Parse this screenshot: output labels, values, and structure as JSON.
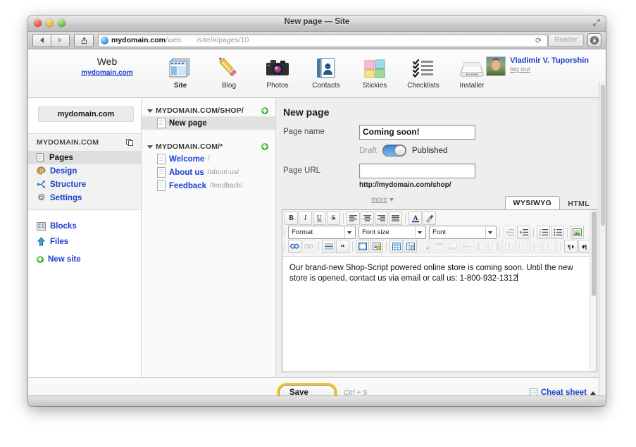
{
  "window": {
    "title": "New page — Site",
    "traffic_lights": [
      "close-button",
      "minimize-button",
      "zoom-button"
    ]
  },
  "browser": {
    "back_label": "Back",
    "forward_label": "Forward",
    "share_label": "Share",
    "address_host": "mydomain.com",
    "address_host_suffix": "/web",
    "address_path": "/site/#/pages/10",
    "reload_glyph": "⟳",
    "reader_label": "Reader",
    "downloads_label": "Downloads"
  },
  "app_header": {
    "brand_title": "Web",
    "brand_domain": "mydomain.com",
    "apps": [
      {
        "label": "Site",
        "icon": "site-icon",
        "selected": true
      },
      {
        "label": "Blog",
        "icon": "pencil-icon",
        "selected": false
      },
      {
        "label": "Photos",
        "icon": "camera-icon",
        "selected": false
      },
      {
        "label": "Contacts",
        "icon": "contacts-icon",
        "selected": false
      },
      {
        "label": "Stickies",
        "icon": "stickies-icon",
        "selected": false
      },
      {
        "label": "Checklists",
        "icon": "checklist-icon",
        "selected": false
      },
      {
        "label": "Installer",
        "icon": "installer-icon",
        "selected": false
      }
    ],
    "user": {
      "name": "Vladimir V. Tuporshin",
      "logout_label": "log out"
    }
  },
  "sidebar": {
    "domain_box": "mydomain.com",
    "group_header": "MYDOMAIN.COM",
    "group_header_icon": "duplicate-icon",
    "items": [
      {
        "label": "Pages",
        "icon": "pages-icon",
        "active": true
      },
      {
        "label": "Design",
        "icon": "palette-icon",
        "active": false
      },
      {
        "label": "Structure",
        "icon": "structure-icon",
        "active": false
      },
      {
        "label": "Settings",
        "icon": "gear-icon",
        "active": false
      }
    ],
    "extras": [
      {
        "label": "Blocks",
        "icon": "blocks-icon"
      },
      {
        "label": "Files",
        "icon": "upload-icon"
      }
    ],
    "new_site_label": "New site"
  },
  "tree": {
    "groups": [
      {
        "header": "MYDOMAIN.COM/SHOP/",
        "add_label": "add-page",
        "pages": [
          {
            "name": "New page",
            "slug": "",
            "selected": true
          }
        ]
      },
      {
        "header": "MYDOMAIN.COM/*",
        "add_label": "add-page",
        "pages": [
          {
            "name": "Welcome",
            "slug": "/",
            "selected": false
          },
          {
            "name": "About us",
            "slug": "/about-us/",
            "selected": false
          },
          {
            "name": "Feedback",
            "slug": "/feedback/",
            "selected": false
          }
        ]
      }
    ]
  },
  "main": {
    "heading": "New page",
    "page_name_label": "Page name",
    "page_name_value": "Coming soon!",
    "draft_label": "Draft",
    "published_label": "Published",
    "toggle_state": "published",
    "page_url_label": "Page URL",
    "page_url_value": "",
    "page_url_hint": "http://mydomain.com/shop/",
    "more_label": "more",
    "tabs": [
      {
        "label": "WYSIWYG",
        "active": true
      },
      {
        "label": "HTML",
        "active": false
      }
    ],
    "editor": {
      "row1": [
        {
          "name": "bold-button",
          "glyph": "B",
          "style": "bold",
          "disabled": false
        },
        {
          "name": "italic-button",
          "glyph": "I",
          "style": "italic",
          "disabled": false
        },
        {
          "name": "underline-button",
          "glyph": "U",
          "style": "underline",
          "disabled": false
        },
        {
          "name": "strikethrough-button",
          "glyph": "S",
          "style": "strike",
          "disabled": false
        },
        {
          "name": "align-left-button",
          "glyph": "lines-left",
          "style": "icon",
          "disabled": false
        },
        {
          "name": "align-center-button",
          "glyph": "lines-center",
          "style": "icon",
          "disabled": false
        },
        {
          "name": "align-right-button",
          "glyph": "lines-right",
          "style": "icon",
          "disabled": false
        },
        {
          "name": "align-justify-button",
          "glyph": "lines-justify",
          "style": "icon",
          "disabled": false
        },
        {
          "name": "text-color-button",
          "glyph": "A",
          "style": "color",
          "disabled": false
        },
        {
          "name": "remove-format-button",
          "glyph": "brush",
          "style": "icon",
          "disabled": false
        }
      ],
      "selects": [
        {
          "name": "format-select",
          "label": "Format"
        },
        {
          "name": "font-size-select",
          "label": "Font size"
        },
        {
          "name": "font-select",
          "label": "Font"
        }
      ],
      "row2_right": [
        {
          "name": "outdent-button",
          "disabled": true
        },
        {
          "name": "indent-button",
          "disabled": false
        },
        {
          "name": "ordered-list-button",
          "disabled": false
        },
        {
          "name": "unordered-list-button",
          "disabled": false
        },
        {
          "name": "insert-image-button",
          "disabled": false
        }
      ],
      "row3": [
        {
          "name": "insert-link-button",
          "disabled": false
        },
        {
          "name": "unlink-button",
          "disabled": true
        },
        {
          "name": "horizontal-rule-button",
          "disabled": false
        },
        {
          "name": "blockquote-button",
          "disabled": false
        },
        {
          "name": "anchor-button",
          "disabled": false
        },
        {
          "name": "insert-media-button",
          "disabled": false
        },
        {
          "name": "insert-table-button",
          "disabled": false
        },
        {
          "name": "table-properties-button",
          "disabled": false
        },
        {
          "name": "delete-table-button",
          "disabled": true
        },
        {
          "name": "insert-row-before-button",
          "disabled": true
        },
        {
          "name": "insert-row-after-button",
          "disabled": true
        },
        {
          "name": "delete-row-button",
          "disabled": true
        },
        {
          "name": "insert-column-before-button",
          "disabled": true
        },
        {
          "name": "insert-column-after-button",
          "disabled": true
        },
        {
          "name": "delete-column-button",
          "disabled": true
        },
        {
          "name": "split-cell-button",
          "disabled": true
        },
        {
          "name": "merge-cell-button",
          "disabled": true
        },
        {
          "name": "cell-properties-button",
          "disabled": true
        },
        {
          "name": "ltr-direction-button",
          "disabled": false
        },
        {
          "name": "rtl-direction-button",
          "disabled": false
        }
      ],
      "body_text": "Our brand-new Shop-Script powered online store is coming soon. Until the new store is opened, contact us via email or call us: 1-800-932-1312"
    }
  },
  "footer": {
    "save_label": "Save",
    "save_shortcut": "Ctrl + S",
    "cheat_sheet_label": "Cheat sheet",
    "cheat_sheet_icon": "document-icon"
  },
  "colors": {
    "link": "#1a3fd0",
    "accent_focus": "#f5c518",
    "toggle_on": "#3f8fd6",
    "add_green": "#35a430"
  }
}
